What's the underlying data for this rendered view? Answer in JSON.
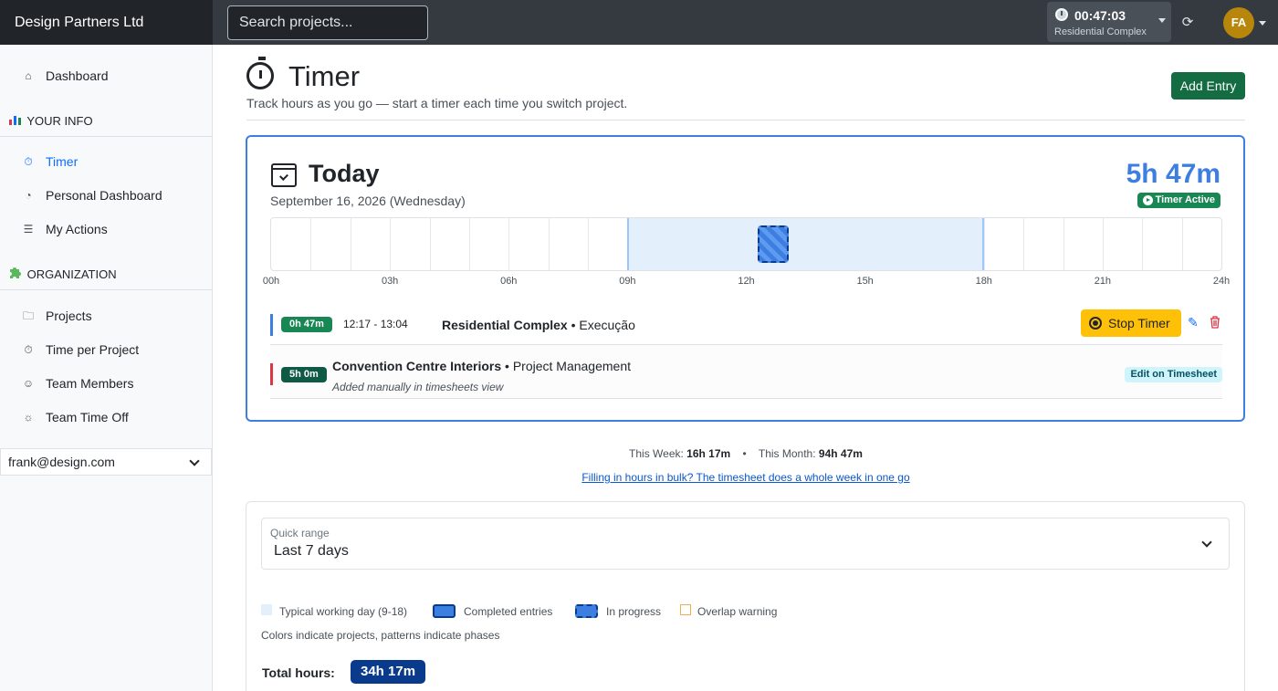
{
  "app": {
    "brand": "Design Partners Ltd"
  },
  "search": {
    "placeholder": "Search projects..."
  },
  "topbar": {
    "timer": {
      "time": "00:47:03",
      "project": "Residential Complex"
    },
    "avatar_initials": "FA"
  },
  "sidebar": {
    "dashboard": "Dashboard",
    "section_your_info": "YOUR INFO",
    "your_info_items": [
      {
        "label": "Timer",
        "active": true
      },
      {
        "label": "Personal Dashboard"
      },
      {
        "label": "My Actions"
      }
    ],
    "section_organization": "ORGANIZATION",
    "organization_items": [
      {
        "label": "Projects"
      },
      {
        "label": "Time per Project"
      },
      {
        "label": "Team Members"
      },
      {
        "label": "Team Time Off"
      }
    ],
    "user_select": "frank@design.com"
  },
  "page": {
    "title": "Timer",
    "subtitle": "Track hours as you go — start a timer each time you switch project.",
    "add_entry": "Add Entry"
  },
  "today": {
    "title": "Today",
    "date": "September 16, 2026  (Wednesday)",
    "total": "5h 47m",
    "status": "Timer Active",
    "timeline": {
      "ticks": [
        "00h",
        "03h",
        "06h",
        "09h",
        "12h",
        "15h",
        "18h",
        "21h",
        "24h"
      ],
      "hours_span": 24,
      "working_start_hour": 9,
      "working_end_hour": 18,
      "in_progress_start_hour": 12.28,
      "in_progress_end_hour": 13.07
    },
    "entries": [
      {
        "duration": "0h 47m",
        "time_range": "12:17 - 13:04",
        "project": "Residential Complex",
        "separator": " • ",
        "phase": "Execução",
        "stop_label": "Stop Timer",
        "bar_color": "#3d7fe0",
        "badge_color": "#198754"
      },
      {
        "duration": "5h 0m",
        "project": "Convention Centre Interiors",
        "separator": " • ",
        "phase": "Project Management",
        "note": "Added manually in timesheets view",
        "edit_label": "Edit on Timesheet",
        "bar_color": "#dc3545",
        "badge_color": "#0f5a45"
      }
    ]
  },
  "summary": {
    "week_label": "This Week:",
    "week_value": "16h 17m",
    "month_label": "This Month:",
    "month_value": "94h 47m",
    "separator": "•",
    "bulk_link": "Filling in hours in bulk? The timesheet does a whole week in one go"
  },
  "range": {
    "label": "Quick range",
    "value": "Last 7 days",
    "legend": [
      {
        "label": "Typical working day (9-18)"
      },
      {
        "label": "Completed entries"
      },
      {
        "label": "In progress"
      },
      {
        "label": "Overlap warning"
      }
    ],
    "legend_note": "Colors indicate projects, patterns indicate phases",
    "total_label": "Total hours:",
    "total_value": "34h 17m"
  }
}
